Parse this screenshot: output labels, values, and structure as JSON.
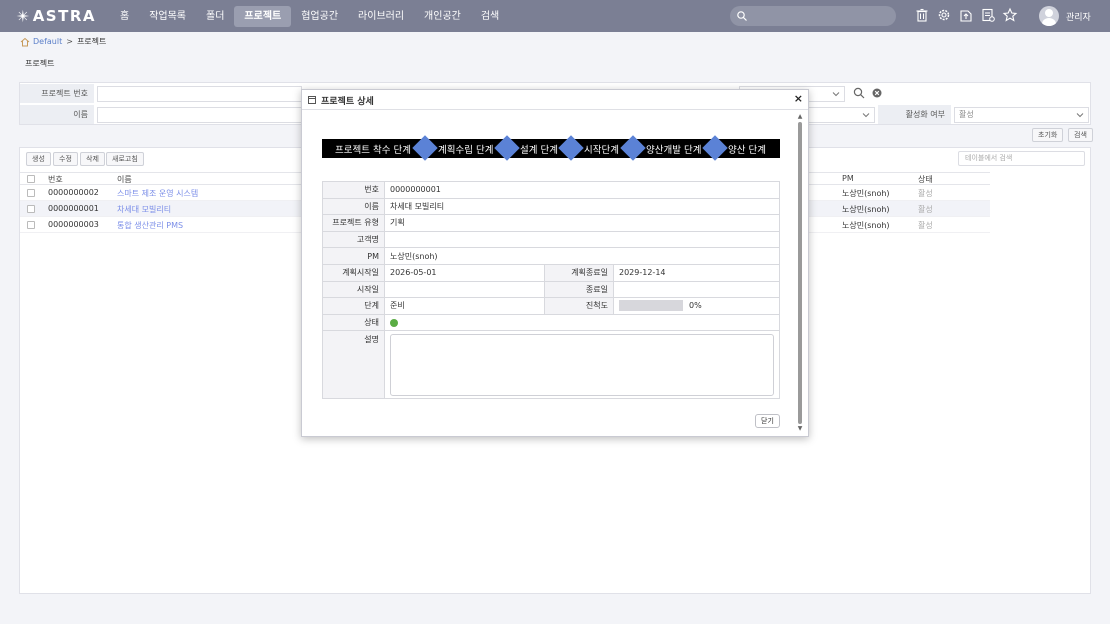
{
  "app": {
    "logo_text": "ASTRA"
  },
  "nav": [
    {
      "label": "홈"
    },
    {
      "label": "작업목록"
    },
    {
      "label": "폴더"
    },
    {
      "label": "프로젝트"
    },
    {
      "label": "협업공간"
    },
    {
      "label": "라이브러리"
    },
    {
      "label": "개인공간"
    },
    {
      "label": "검색"
    }
  ],
  "search": {
    "placeholder": ""
  },
  "toolbar_icons": [
    "trash-icon",
    "gear-icon",
    "export-icon",
    "document-icon",
    "star-icon"
  ],
  "user": {
    "name": "관리자"
  },
  "breadcrumb": {
    "root": "Default",
    "separator": ">",
    "current": "프로젝트"
  },
  "page": {
    "title": "프로젝트"
  },
  "filter": {
    "project_no_label": "프로젝트 번호",
    "name_label": "이름",
    "active_label": "활성화 여부",
    "active_value": "활성",
    "reset_label": "초기화",
    "search_label": "검색"
  },
  "list": {
    "buttons": {
      "create": "생성",
      "edit": "수정",
      "delete": "삭제",
      "refresh": "새로고침"
    },
    "table_search_placeholder": "테이블에서 검색",
    "columns": {
      "no": "번호",
      "name": "이름",
      "pm": "PM",
      "status": "상태"
    },
    "rows": [
      {
        "no": "0000000002",
        "name": "스마트 제조 운영 시스템",
        "pm": "노상민(snoh)",
        "status": "활성"
      },
      {
        "no": "0000000001",
        "name": "차세대 모빌리티",
        "pm": "노상민(snoh)",
        "status": "활성"
      },
      {
        "no": "0000000003",
        "name": "통합 생산관리 PMS",
        "pm": "노상민(snoh)",
        "status": "활성"
      }
    ]
  },
  "modal": {
    "title": "프로젝트 상세",
    "close_x": "×",
    "stages": [
      "프로젝트 착수 단계",
      "계획수립 단계",
      "설계 단계",
      "시작단계",
      "양산개발 단계",
      "양산 단계"
    ],
    "labels": {
      "no": "번호",
      "name": "이름",
      "type": "프로젝트 유형",
      "customer": "고객명",
      "pm": "PM",
      "plan_start": "계획시작일",
      "plan_end": "계획종료일",
      "start": "시작일",
      "end": "종료일",
      "stage": "단계",
      "progress": "진척도",
      "status": "상태",
      "description": "설명"
    },
    "values": {
      "no": "0000000001",
      "name": "차세대 모빌리티",
      "type": "기획",
      "customer": "",
      "pm": "노상민(snoh)",
      "plan_start": "2026-05-01",
      "plan_end": "2029-12-14",
      "start": "",
      "end": "",
      "stage": "준비",
      "progress_text": "0%",
      "progress": 0,
      "status_color": "#5aac44"
    },
    "close_button": "닫기"
  },
  "colors": {
    "topbar": "#7b7f94",
    "stage_diamond": "#5b82d6",
    "link": "#7b8ee8"
  }
}
